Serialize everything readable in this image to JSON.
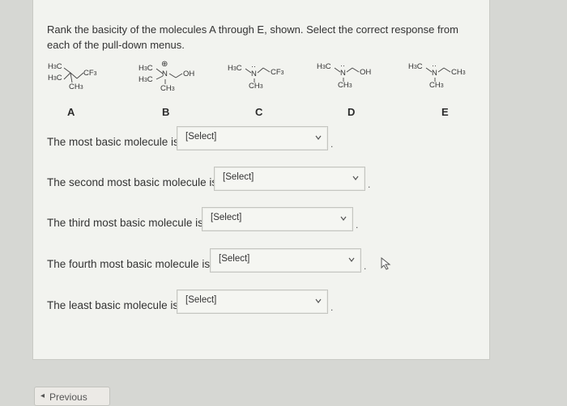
{
  "question": {
    "prompt": "Rank the basicity of the molecules A through E, shown. Select the correct response from each of the pull-down menus."
  },
  "molecules": [
    {
      "label": "A"
    },
    {
      "label": "B"
    },
    {
      "label": "C"
    },
    {
      "label": "D"
    },
    {
      "label": "E"
    }
  ],
  "chem": {
    "h3c": "H3C",
    "ch3": "CH3",
    "cf3": "CF3",
    "n": "N",
    "oh": "OH",
    "plus": "⊕"
  },
  "dropdowns": [
    {
      "text": "The most basic molecule is",
      "value": "[Select]"
    },
    {
      "text": "The second most basic molecule is",
      "value": "[Select]"
    },
    {
      "text": "The third most basic molecule is",
      "value": "[Select]"
    },
    {
      "text": "The fourth most basic molecule is",
      "value": "[Select]"
    },
    {
      "text": "The least basic molecule is",
      "value": "[Select]"
    }
  ],
  "nav": {
    "previous_label": "Previous"
  },
  "icons": {
    "chevron": "chevron-down-icon",
    "cursor": "mouse-pointer-icon"
  }
}
